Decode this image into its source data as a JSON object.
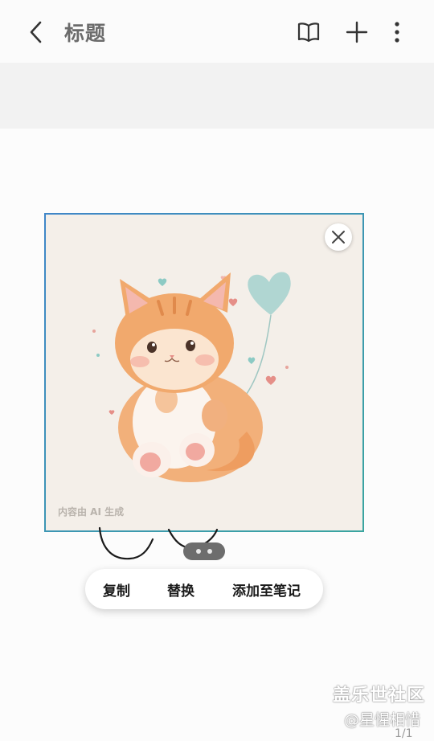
{
  "header": {
    "title": "标题",
    "icons": {
      "back": "back-arrow-icon",
      "reading_mode": "open-book-icon",
      "add": "plus-icon",
      "more": "more-vertical-icon"
    }
  },
  "image": {
    "subject": "watercolor orange kitten holding heart balloon",
    "watermark": "内容由 AI 生成",
    "close_icon": "close-icon"
  },
  "context_menu": {
    "items": [
      {
        "label": "复制"
      },
      {
        "label": "替换"
      },
      {
        "label": "添加至笔记"
      }
    ]
  },
  "watermark": {
    "site": "盖乐世社区",
    "user": "@星惺相惜"
  },
  "page_indicator": "1/1",
  "colors": {
    "frame_gradient_start": "#3f86c8",
    "frame_gradient_end": "#3aa5a0",
    "band": "#f2f2f2",
    "background": "#fcfcfc"
  }
}
